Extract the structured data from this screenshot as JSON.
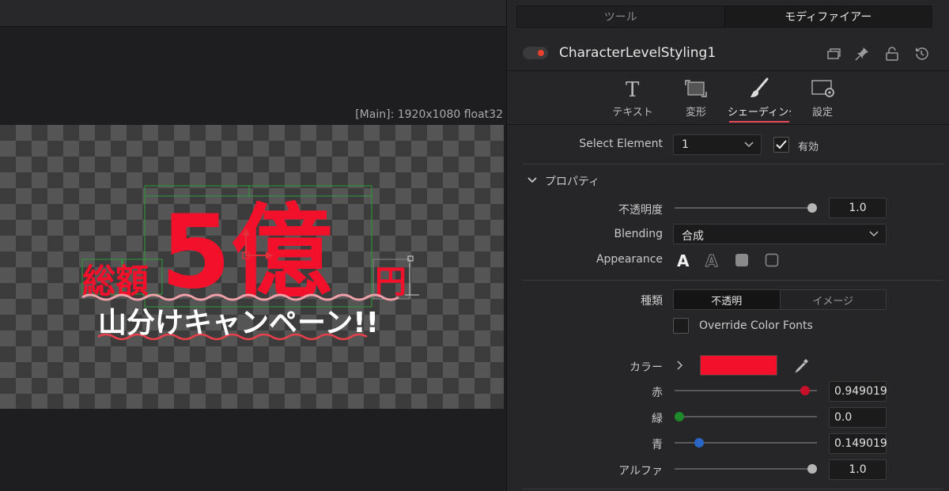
{
  "viewer": {
    "info": "[Main]: 1920x1080 float32",
    "canvas_text": {
      "line1_prefix": "総額",
      "line1_big": "5億",
      "line1_suffix": "円",
      "line2": "山分けキャンペーン!!"
    }
  },
  "inspector": {
    "top_tabs": [
      {
        "label": "ツール",
        "active": false
      },
      {
        "label": "モディファイアー",
        "active": true
      }
    ],
    "tool_name": "CharacterLevelStyling1",
    "header_icons": [
      "collapse-icon",
      "pin-icon",
      "lock-icon",
      "reset-icon"
    ],
    "sub_tabs": [
      {
        "label": "テキスト",
        "icon": "text-icon",
        "active": false
      },
      {
        "label": "変形",
        "icon": "transform-icon",
        "active": false
      },
      {
        "label": "シェーディング",
        "icon": "brush-icon",
        "active": true
      },
      {
        "label": "設定",
        "icon": "settings-icon",
        "active": false
      }
    ],
    "select_element": {
      "label": "Select Element",
      "value": "1",
      "enabled_label": "有効",
      "enabled": true
    },
    "section": {
      "title": "プロパティ",
      "expanded": true
    },
    "opacity": {
      "label": "不透明度",
      "value": "1.0",
      "level": 1.0
    },
    "blending": {
      "label": "Blending",
      "value": "合成"
    },
    "appearance": {
      "label": "Appearance",
      "options": [
        "A",
        "A",
        "filled-rect",
        "outline-rect"
      ],
      "selected": 0
    },
    "type": {
      "label": "種類",
      "options": [
        "不透明",
        "イメージ"
      ],
      "selected": 0
    },
    "override_color_fonts": {
      "label": "Override Color Fonts",
      "checked": false
    },
    "color": {
      "label": "カラー",
      "swatch": "#f2102a",
      "red": {
        "label": "赤",
        "value": "0.949019",
        "level": 0.949019,
        "knob_color": "#c8102a"
      },
      "green": {
        "label": "緑",
        "value": "0.0",
        "level": 0.0,
        "knob_color": "#1f8a2c"
      },
      "blue": {
        "label": "青",
        "value": "0.149019",
        "level": 0.149019,
        "knob_color": "#2a66c6"
      },
      "alpha": {
        "label": "アルファ",
        "value": "1.0",
        "level": 1.0,
        "knob_color": "#b5b5b5"
      }
    }
  }
}
